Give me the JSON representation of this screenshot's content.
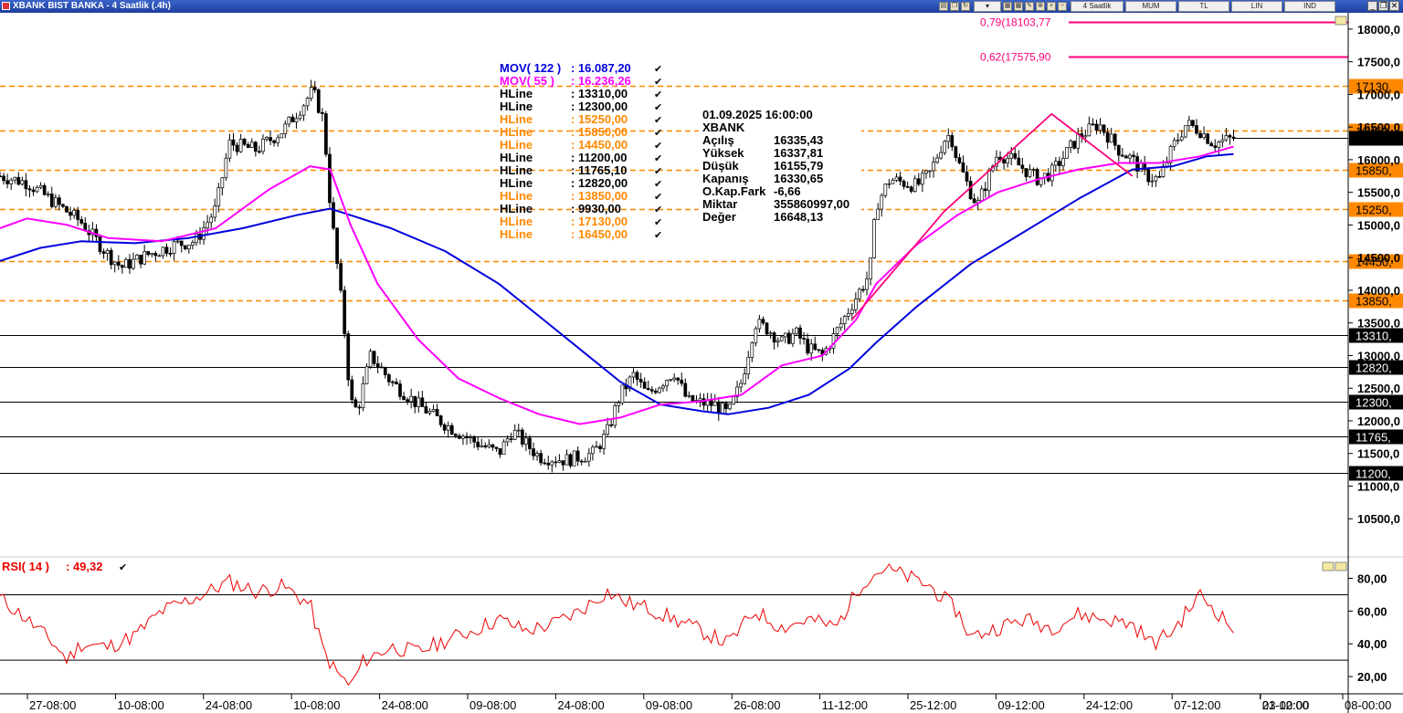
{
  "window": {
    "title": "XBANK BIST BANKA - 4 Saatlik (.4h)"
  },
  "toolbar": {
    "period": "4 Saatlik",
    "chart_type": "MUM",
    "currency": "TL",
    "scale": "LIN",
    "ind": "IND"
  },
  "colors": {
    "orange": "#ff8800",
    "blue": "#0000dd",
    "magenta": "#ff00ff",
    "fib": "#ff0077",
    "rsi": "#ee0000",
    "black": "#000000"
  },
  "legend": {
    "ma": [
      {
        "label": "MOV( 122 )",
        "value": ": 16.087,20",
        "color": "#0000dd"
      },
      {
        "label": "MOV( 55 )",
        "value": ": 16.236,26",
        "color": "#ff00ff"
      }
    ],
    "hlines": [
      {
        "label": "HLine",
        "value": ": 13310,00",
        "color": "#000000"
      },
      {
        "label": "HLine",
        "value": ": 12300,00",
        "color": "#000000"
      },
      {
        "label": "HLine",
        "value": ": 15250,00",
        "color": "#ff8800"
      },
      {
        "label": "HLine",
        "value": ": 15850,00",
        "color": "#ff8800"
      },
      {
        "label": "HLine",
        "value": ": 14450,00",
        "color": "#ff8800"
      },
      {
        "label": "HLine",
        "value": ": 11200,00",
        "color": "#000000"
      },
      {
        "label": "HLine",
        "value": ": 11765,10",
        "color": "#000000"
      },
      {
        "label": "HLine",
        "value": ": 12820,00",
        "color": "#000000"
      },
      {
        "label": "HLine",
        "value": ": 13850,00",
        "color": "#ff8800"
      },
      {
        "label": "HLine",
        "value": ": 9930,00",
        "color": "#000000"
      },
      {
        "label": "HLine",
        "value": ": 17130,00",
        "color": "#ff8800"
      },
      {
        "label": "HLine",
        "value": ": 16450,00",
        "color": "#ff8800"
      }
    ]
  },
  "info": {
    "datetime": "01.09.2025  16:00:00",
    "symbol": "XBANK",
    "rows": [
      {
        "label": "Açılış",
        "value": "16335,43"
      },
      {
        "label": "Yüksek",
        "value": "16337,81"
      },
      {
        "label": "Düşük",
        "value": "16155,79"
      },
      {
        "label": "Kapanış",
        "value": "16330,65"
      },
      {
        "label": "O.Kap.Fark",
        "value": "-6,66"
      },
      {
        "label": "Miktar",
        "value": "355860997,00"
      },
      {
        "label": "Değer",
        "value": "16648,13"
      }
    ]
  },
  "rsi_label": {
    "label": "RSI( 14 )",
    "value": ": 49,32"
  },
  "chart_data": {
    "type": "candlestick",
    "symbol": "XBANK",
    "period": "4 Saatlik",
    "price_axis": {
      "range": [
        9930,
        18250
      ],
      "ticks": [
        "18000,0",
        "17500,0",
        "17000,0",
        "16500,0",
        "16000,0",
        "15500,0",
        "15000,0",
        "14500,0",
        "14000,0",
        "13500,0",
        "13000,0",
        "12500,0",
        "12000,0",
        "11500,0",
        "11000,0",
        "10500,0"
      ],
      "tick_values": [
        18000,
        17500,
        17000,
        16500,
        16000,
        15500,
        15000,
        14500,
        14000,
        13500,
        13000,
        12500,
        12000,
        11500,
        11000,
        10500
      ]
    },
    "x_axis": {
      "labels": [
        "27-08:00",
        "10-08:00",
        "24-08:00",
        "10-08:00",
        "24-08:00",
        "09-08:00",
        "24-08:00",
        "09-08:00",
        "26-08:00",
        "11-12:00",
        "25-12:00",
        "09-12:00",
        "24-12:00",
        "07-12:00",
        "21-12:00",
        "03-00:00",
        "08-00:00"
      ],
      "start_label": "27-08:00",
      "end_label": "08-00:00"
    },
    "hlines": [
      {
        "value": 17130,
        "label": "17130,",
        "color": "#ff8800",
        "style": "dashed"
      },
      {
        "value": 16450,
        "label": "16450,",
        "color": "#ff8800",
        "style": "dashed"
      },
      {
        "value": 15850,
        "label": "15850,",
        "color": "#ff8800",
        "style": "dashed"
      },
      {
        "value": 15250,
        "label": "15250,",
        "color": "#ff8800",
        "style": "dashed"
      },
      {
        "value": 14450,
        "label": "14450,",
        "color": "#ff8800",
        "style": "dashed"
      },
      {
        "value": 13850,
        "label": "13850,",
        "color": "#ff8800",
        "style": "dashed"
      },
      {
        "value": 13310,
        "label": "13310,",
        "color": "#000000",
        "style": "solid"
      },
      {
        "value": 12820,
        "label": "12820,",
        "color": "#000000",
        "style": "solid"
      },
      {
        "value": 12300,
        "label": "12300,",
        "color": "#000000",
        "style": "solid"
      },
      {
        "value": 11765.1,
        "label": "11765,",
        "color": "#000000",
        "style": "solid"
      },
      {
        "value": 11200,
        "label": "11200,",
        "color": "#000000",
        "style": "solid"
      }
    ],
    "last_close": 16330.65,
    "fib_levels": [
      {
        "label": "0,79(18103,77",
        "value": 18103.77
      },
      {
        "label": "0,62(17575,90",
        "value": 17575.9
      }
    ],
    "price_path": [
      [
        0,
        15750
      ],
      [
        0.02,
        15650
      ],
      [
        0.04,
        15350
      ],
      [
        0.06,
        15050
      ],
      [
        0.08,
        14550
      ],
      [
        0.09,
        14350
      ],
      [
        0.11,
        14550
      ],
      [
        0.13,
        14700
      ],
      [
        0.145,
        14750
      ],
      [
        0.16,
        15250
      ],
      [
        0.17,
        16250
      ],
      [
        0.19,
        16150
      ],
      [
        0.21,
        16450
      ],
      [
        0.225,
        16850
      ],
      [
        0.232,
        17060
      ],
      [
        0.24,
        16600
      ],
      [
        0.245,
        15300
      ],
      [
        0.255,
        13500
      ],
      [
        0.26,
        12300
      ],
      [
        0.265,
        12150
      ],
      [
        0.275,
        13000
      ],
      [
        0.29,
        12600
      ],
      [
        0.31,
        12250
      ],
      [
        0.33,
        11950
      ],
      [
        0.35,
        11700
      ],
      [
        0.37,
        11500
      ],
      [
        0.38,
        11850
      ],
      [
        0.39,
        11650
      ],
      [
        0.4,
        11450
      ],
      [
        0.42,
        11400
      ],
      [
        0.44,
        11500
      ],
      [
        0.45,
        11800
      ],
      [
        0.46,
        12400
      ],
      [
        0.47,
        12700
      ],
      [
        0.48,
        12400
      ],
      [
        0.5,
        12750
      ],
      [
        0.51,
        12300
      ],
      [
        0.53,
        12250
      ],
      [
        0.54,
        12100
      ],
      [
        0.55,
        12600
      ],
      [
        0.56,
        13500
      ],
      [
        0.57,
        13400
      ],
      [
        0.58,
        13200
      ],
      [
        0.59,
        13350
      ],
      [
        0.6,
        13100
      ],
      [
        0.61,
        13000
      ],
      [
        0.62,
        13350
      ],
      [
        0.635,
        13900
      ],
      [
        0.645,
        14250
      ],
      [
        0.65,
        15300
      ],
      [
        0.66,
        15700
      ],
      [
        0.68,
        15600
      ],
      [
        0.69,
        15800
      ],
      [
        0.7,
        16300
      ],
      [
        0.705,
        16400
      ],
      [
        0.71,
        16000
      ],
      [
        0.72,
        15500
      ],
      [
        0.725,
        15300
      ],
      [
        0.74,
        16100
      ],
      [
        0.75,
        16000
      ],
      [
        0.77,
        15700
      ],
      [
        0.78,
        15800
      ],
      [
        0.8,
        16350
      ],
      [
        0.815,
        16550
      ],
      [
        0.83,
        16150
      ],
      [
        0.84,
        16000
      ],
      [
        0.85,
        15750
      ],
      [
        0.86,
        15700
      ],
      [
        0.87,
        16200
      ],
      [
        0.88,
        16550
      ],
      [
        0.89,
        16450
      ],
      [
        0.9,
        16250
      ],
      [
        0.91,
        16300
      ],
      [
        0.915,
        16330
      ]
    ],
    "ma55_path": [
      [
        0,
        14950
      ],
      [
        0.02,
        15100
      ],
      [
        0.05,
        15000
      ],
      [
        0.08,
        14800
      ],
      [
        0.12,
        14750
      ],
      [
        0.16,
        14950
      ],
      [
        0.2,
        15550
      ],
      [
        0.23,
        15900
      ],
      [
        0.245,
        15850
      ],
      [
        0.26,
        15000
      ],
      [
        0.28,
        14100
      ],
      [
        0.31,
        13250
      ],
      [
        0.34,
        12650
      ],
      [
        0.37,
        12350
      ],
      [
        0.4,
        12100
      ],
      [
        0.43,
        11950
      ],
      [
        0.46,
        12050
      ],
      [
        0.49,
        12250
      ],
      [
        0.52,
        12300
      ],
      [
        0.55,
        12400
      ],
      [
        0.58,
        12850
      ],
      [
        0.61,
        13000
      ],
      [
        0.635,
        13550
      ],
      [
        0.65,
        14100
      ],
      [
        0.68,
        14700
      ],
      [
        0.71,
        15150
      ],
      [
        0.74,
        15500
      ],
      [
        0.77,
        15700
      ],
      [
        0.8,
        15850
      ],
      [
        0.83,
        15950
      ],
      [
        0.86,
        15950
      ],
      [
        0.89,
        16050
      ],
      [
        0.915,
        16200
      ]
    ],
    "ma122_path": [
      [
        0,
        14450
      ],
      [
        0.03,
        14650
      ],
      [
        0.06,
        14750
      ],
      [
        0.1,
        14720
      ],
      [
        0.14,
        14800
      ],
      [
        0.18,
        14950
      ],
      [
        0.22,
        15150
      ],
      [
        0.245,
        15250
      ],
      [
        0.26,
        15150
      ],
      [
        0.29,
        14950
      ],
      [
        0.33,
        14600
      ],
      [
        0.37,
        14100
      ],
      [
        0.4,
        13600
      ],
      [
        0.43,
        13100
      ],
      [
        0.46,
        12600
      ],
      [
        0.49,
        12250
      ],
      [
        0.52,
        12150
      ],
      [
        0.54,
        12100
      ],
      [
        0.57,
        12200
      ],
      [
        0.6,
        12400
      ],
      [
        0.63,
        12800
      ],
      [
        0.65,
        13200
      ],
      [
        0.68,
        13750
      ],
      [
        0.72,
        14400
      ],
      [
        0.76,
        14900
      ],
      [
        0.8,
        15400
      ],
      [
        0.84,
        15850
      ],
      [
        0.87,
        15900
      ],
      [
        0.895,
        16050
      ],
      [
        0.915,
        16087
      ]
    ],
    "trend_segments": [
      [
        [
          0.632,
          13550
        ],
        [
          0.7,
          15200
        ],
        [
          0.78,
          16700
        ],
        [
          0.84,
          15750
        ]
      ]
    ],
    "rsi": {
      "name": "RSI( 14 )",
      "last": 49.32,
      "range": [
        10,
        92
      ],
      "ticks": [
        "80,00",
        "60,00",
        "40,00",
        "20,00"
      ],
      "tick_values": [
        80,
        60,
        40,
        20
      ],
      "levels": [
        70,
        30
      ],
      "path": [
        [
          0,
          68
        ],
        [
          0.02,
          55
        ],
        [
          0.04,
          40
        ],
        [
          0.05,
          30
        ],
        [
          0.06,
          40
        ],
        [
          0.08,
          38
        ],
        [
          0.1,
          45
        ],
        [
          0.12,
          60
        ],
        [
          0.15,
          70
        ],
        [
          0.17,
          78
        ],
        [
          0.19,
          72
        ],
        [
          0.21,
          75
        ],
        [
          0.23,
          64
        ],
        [
          0.24,
          35
        ],
        [
          0.25,
          22
        ],
        [
          0.26,
          14
        ],
        [
          0.27,
          30
        ],
        [
          0.29,
          38
        ],
        [
          0.31,
          35
        ],
        [
          0.33,
          42
        ],
        [
          0.35,
          48
        ],
        [
          0.37,
          55
        ],
        [
          0.39,
          48
        ],
        [
          0.41,
          52
        ],
        [
          0.43,
          60
        ],
        [
          0.45,
          72
        ],
        [
          0.465,
          65
        ],
        [
          0.48,
          62
        ],
        [
          0.5,
          55
        ],
        [
          0.52,
          48
        ],
        [
          0.54,
          40
        ],
        [
          0.56,
          60
        ],
        [
          0.58,
          50
        ],
        [
          0.6,
          55
        ],
        [
          0.62,
          50
        ],
        [
          0.64,
          78
        ],
        [
          0.655,
          86
        ],
        [
          0.67,
          82
        ],
        [
          0.69,
          75
        ],
        [
          0.71,
          60
        ],
        [
          0.72,
          44
        ],
        [
          0.74,
          50
        ],
        [
          0.76,
          55
        ],
        [
          0.78,
          50
        ],
        [
          0.8,
          58
        ],
        [
          0.82,
          55
        ],
        [
          0.84,
          52
        ],
        [
          0.855,
          40
        ],
        [
          0.87,
          48
        ],
        [
          0.89,
          70
        ],
        [
          0.9,
          62
        ],
        [
          0.915,
          49
        ]
      ]
    }
  }
}
